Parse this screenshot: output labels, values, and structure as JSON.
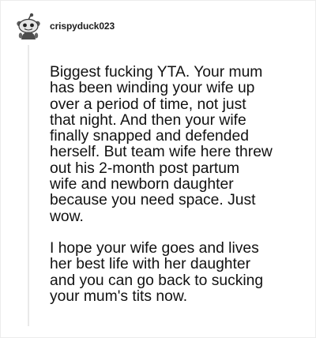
{
  "comment": {
    "username": "crispyduck023",
    "avatar_icon": "reddit-snoo-avatar-icon",
    "paragraphs": [
      "Biggest fucking YTA. Your mum\nhas been winding your wife up\nover a period of time, not just\nthat night. And then your wife\nfinally snapped and defended\nherself. But team wife here threw\nout his 2-month post partum\nwife and newborn daughter\nbecause you need space. Just\nwow.",
      "I hope your wife goes and lives\nher best life with her daughter\nand you can go back to sucking\nyour mum's tits now."
    ]
  },
  "colors": {
    "username": "#1c1c1c",
    "body_text": "#111111",
    "thread_line": "#e9e9e9",
    "border": "#ececec"
  }
}
